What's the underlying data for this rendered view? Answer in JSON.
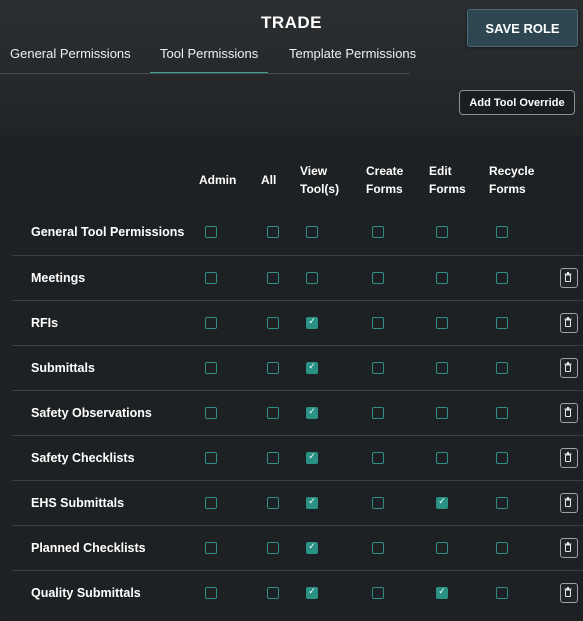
{
  "role": {
    "title": "TRADE"
  },
  "header": {
    "save_label": "SAVE ROLE"
  },
  "tabs": [
    {
      "label": "General Permissions",
      "active": false
    },
    {
      "label": "Tool Permissions",
      "active": true
    },
    {
      "label": "Template Permissions",
      "active": false
    }
  ],
  "toolbar": {
    "add_override_label": "Add Tool Override"
  },
  "columns": [
    {
      "line1": "Admin",
      "line2": ""
    },
    {
      "line1": "All",
      "line2": ""
    },
    {
      "line1": "View",
      "line2": "Tool(s)"
    },
    {
      "line1": "Create",
      "line2": "Forms"
    },
    {
      "line1": "Edit",
      "line2": "Forms"
    },
    {
      "line1": "Recycle",
      "line2": "Forms"
    }
  ],
  "rows": [
    {
      "label": "General Tool Permissions",
      "checks": [
        false,
        false,
        false,
        false,
        false,
        false
      ],
      "deletable": false
    },
    {
      "label": "Meetings",
      "checks": [
        false,
        false,
        false,
        false,
        false,
        false
      ],
      "deletable": true
    },
    {
      "label": "RFIs",
      "checks": [
        false,
        false,
        true,
        false,
        false,
        false
      ],
      "deletable": true
    },
    {
      "label": "Submittals",
      "checks": [
        false,
        false,
        true,
        false,
        false,
        false
      ],
      "deletable": true
    },
    {
      "label": "Safety Observations",
      "checks": [
        false,
        false,
        true,
        false,
        false,
        false
      ],
      "deletable": true
    },
    {
      "label": "Safety Checklists",
      "checks": [
        false,
        false,
        true,
        false,
        false,
        false
      ],
      "deletable": true
    },
    {
      "label": "EHS Submittals",
      "checks": [
        false,
        false,
        true,
        false,
        true,
        false
      ],
      "deletable": true
    },
    {
      "label": "Planned Checklists",
      "checks": [
        false,
        false,
        true,
        false,
        false,
        false
      ],
      "deletable": true
    },
    {
      "label": "Quality Submittals",
      "checks": [
        false,
        false,
        true,
        false,
        true,
        false
      ],
      "deletable": true
    }
  ],
  "icons": {
    "checkbox_checked": "check-icon",
    "delete": "trash-icon"
  },
  "colors": {
    "accent": "#2a9184",
    "save_button": "#2d4651",
    "background": "#1e2123"
  }
}
